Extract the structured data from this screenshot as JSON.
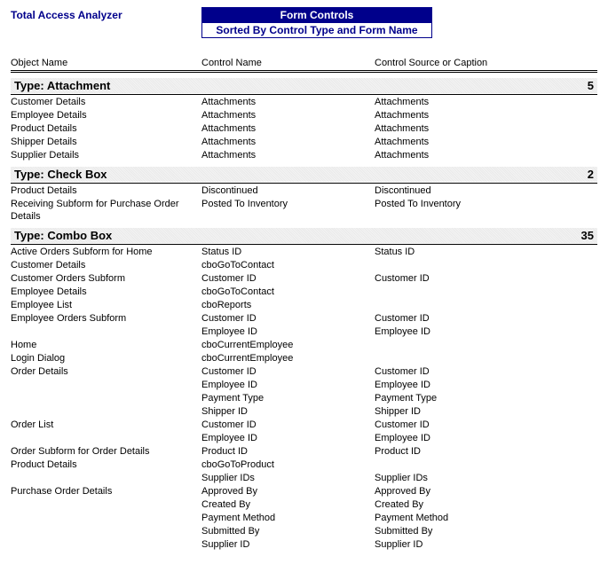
{
  "app_title": "Total Access Analyzer",
  "report_title": "Form Controls",
  "report_subtitle": "Sorted By Control Type and Form Name",
  "columns": {
    "object_name": "Object Name",
    "control_name": "Control Name",
    "control_source": "Control Source or Caption"
  },
  "groups": [
    {
      "type_label": "Type: Attachment",
      "count": "5",
      "rows": [
        {
          "obj": "Customer Details",
          "ctrl": "Attachments",
          "src": "Attachments"
        },
        {
          "obj": "Employee Details",
          "ctrl": "Attachments",
          "src": "Attachments"
        },
        {
          "obj": "Product Details",
          "ctrl": "Attachments",
          "src": "Attachments"
        },
        {
          "obj": "Shipper Details",
          "ctrl": "Attachments",
          "src": "Attachments"
        },
        {
          "obj": "Supplier Details",
          "ctrl": "Attachments",
          "src": "Attachments"
        }
      ]
    },
    {
      "type_label": "Type: Check Box",
      "count": "2",
      "rows": [
        {
          "obj": "Product Details",
          "ctrl": "Discontinued",
          "src": "Discontinued"
        },
        {
          "obj": "Receiving Subform for Purchase Order Details",
          "ctrl": "Posted To Inventory",
          "src": "Posted To Inventory"
        }
      ]
    },
    {
      "type_label": "Type: Combo Box",
      "count": "35",
      "rows": [
        {
          "obj": "Active Orders Subform for Home",
          "ctrl": "Status ID",
          "src": "Status ID"
        },
        {
          "obj": "Customer Details",
          "ctrl": "cboGoToContact",
          "src": ""
        },
        {
          "obj": "Customer Orders Subform",
          "ctrl": "Customer ID",
          "src": "Customer ID"
        },
        {
          "obj": "Employee Details",
          "ctrl": "cboGoToContact",
          "src": ""
        },
        {
          "obj": "Employee List",
          "ctrl": "cboReports",
          "src": ""
        },
        {
          "obj": "Employee Orders Subform",
          "ctrl": "Customer ID",
          "src": "Customer ID"
        },
        {
          "obj": "",
          "ctrl": "Employee ID",
          "src": "Employee ID"
        },
        {
          "obj": "Home",
          "ctrl": "cboCurrentEmployee",
          "src": ""
        },
        {
          "obj": "Login Dialog",
          "ctrl": "cboCurrentEmployee",
          "src": ""
        },
        {
          "obj": "Order Details",
          "ctrl": "Customer ID",
          "src": "Customer ID"
        },
        {
          "obj": "",
          "ctrl": "Employee ID",
          "src": "Employee ID"
        },
        {
          "obj": "",
          "ctrl": "Payment Type",
          "src": "Payment Type"
        },
        {
          "obj": "",
          "ctrl": "Shipper ID",
          "src": "Shipper ID"
        },
        {
          "obj": "Order List",
          "ctrl": "Customer ID",
          "src": "Customer ID"
        },
        {
          "obj": "",
          "ctrl": "Employee ID",
          "src": "Employee ID"
        },
        {
          "obj": "Order Subform for Order Details",
          "ctrl": "Product ID",
          "src": "Product ID"
        },
        {
          "obj": "Product Details",
          "ctrl": "cboGoToProduct",
          "src": ""
        },
        {
          "obj": "",
          "ctrl": "Supplier IDs",
          "src": "Supplier IDs"
        },
        {
          "obj": "Purchase Order Details",
          "ctrl": "Approved By",
          "src": "Approved By"
        },
        {
          "obj": "",
          "ctrl": "Created By",
          "src": "Created By"
        },
        {
          "obj": "",
          "ctrl": "Payment Method",
          "src": "Payment Method"
        },
        {
          "obj": "",
          "ctrl": "Submitted By",
          "src": "Submitted By"
        },
        {
          "obj": "",
          "ctrl": "Supplier ID",
          "src": "Supplier ID"
        }
      ]
    }
  ]
}
